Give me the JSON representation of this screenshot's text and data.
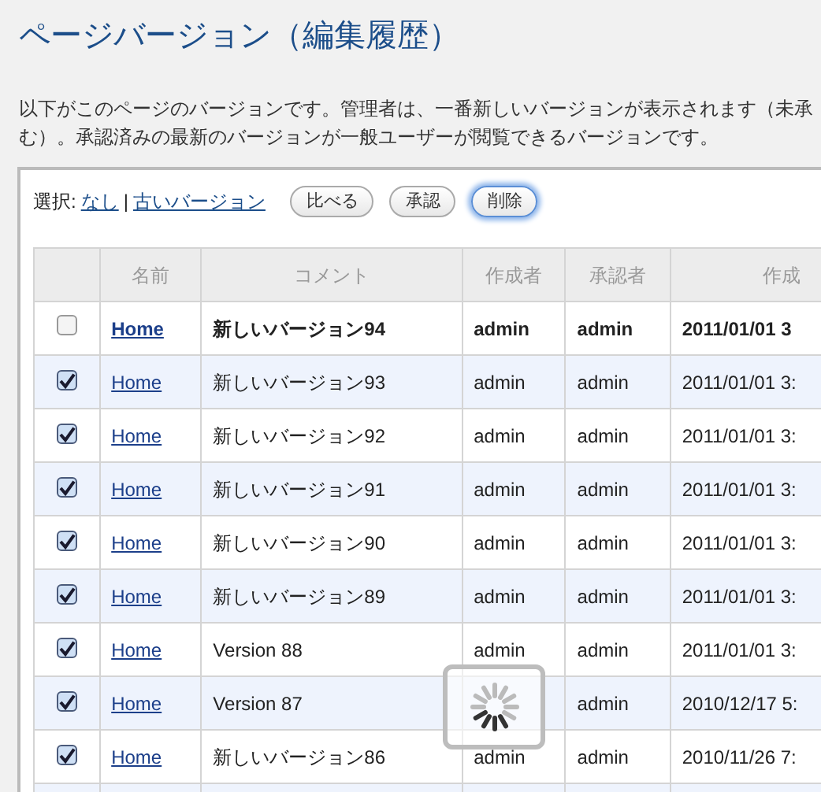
{
  "title": "ページバージョン（編集履歴）",
  "description_lines": [
    "以下がこのページのバージョンです。管理者は、一番新しいバージョンが表示されます（未承",
    "む）。承認済みの最新のバージョンが一般ユーザーが閲覧できるバージョンです。"
  ],
  "toolbar": {
    "select_label": "選択:",
    "links": [
      "なし",
      "古いバージョン"
    ],
    "separator": "|",
    "buttons": [
      {
        "label": "比べる",
        "focused": false
      },
      {
        "label": "承認",
        "focused": false
      },
      {
        "label": "削除",
        "focused": true
      }
    ]
  },
  "table": {
    "columns": [
      "名前",
      "コメント",
      "作成者",
      "承認者",
      "作成"
    ],
    "rows": [
      {
        "checked": false,
        "latest": true,
        "name": "Home",
        "comment": "新しいバージョン94",
        "author": "admin",
        "approver": "admin",
        "created": "2011/01/01 3"
      },
      {
        "checked": true,
        "latest": false,
        "name": "Home",
        "comment": "新しいバージョン93",
        "author": "admin",
        "approver": "admin",
        "created": "2011/01/01 3:"
      },
      {
        "checked": true,
        "latest": false,
        "name": "Home",
        "comment": "新しいバージョン92",
        "author": "admin",
        "approver": "admin",
        "created": "2011/01/01 3:"
      },
      {
        "checked": true,
        "latest": false,
        "name": "Home",
        "comment": "新しいバージョン91",
        "author": "admin",
        "approver": "admin",
        "created": "2011/01/01 3:"
      },
      {
        "checked": true,
        "latest": false,
        "name": "Home",
        "comment": "新しいバージョン90",
        "author": "admin",
        "approver": "admin",
        "created": "2011/01/01 3:"
      },
      {
        "checked": true,
        "latest": false,
        "name": "Home",
        "comment": "新しいバージョン89",
        "author": "admin",
        "approver": "admin",
        "created": "2011/01/01 3:"
      },
      {
        "checked": true,
        "latest": false,
        "name": "Home",
        "comment": "Version 88",
        "author": "admin",
        "approver": "admin",
        "created": "2011/01/01 3:"
      },
      {
        "checked": true,
        "latest": false,
        "name": "Home",
        "comment": "Version 87",
        "approver": "admin",
        "created": "2010/12/17 5:"
      },
      {
        "checked": true,
        "latest": false,
        "name": "Home",
        "comment": "新しいバージョン86",
        "author": "admin",
        "approver": "admin",
        "created": "2010/11/26 7:"
      }
    ]
  },
  "loading": true
}
